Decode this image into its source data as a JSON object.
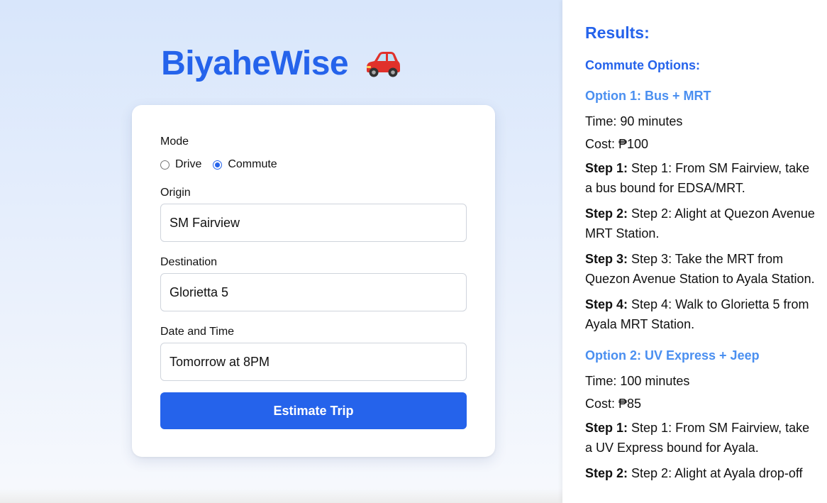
{
  "app": {
    "title": "BiyaheWise"
  },
  "form": {
    "mode_label": "Mode",
    "mode_options": [
      "Drive",
      "Commute"
    ],
    "mode_selected": "Commute",
    "origin_label": "Origin",
    "origin_value": "SM Fairview",
    "destination_label": "Destination",
    "destination_value": "Glorietta 5",
    "datetime_label": "Date and Time",
    "datetime_value": "Tomorrow at 8PM",
    "submit_label": "Estimate Trip"
  },
  "results": {
    "title": "Results:",
    "subtitle": "Commute Options:",
    "options": [
      {
        "title": "Option 1: Bus + MRT",
        "time": "Time: 90 minutes",
        "cost": "Cost: ₱100",
        "steps": [
          {
            "label": "Step 1:",
            "text": "Step 1: From SM Fairview, take a bus bound for EDSA/MRT."
          },
          {
            "label": "Step 2:",
            "text": "Step 2: Alight at Quezon Avenue MRT Station."
          },
          {
            "label": "Step 3:",
            "text": "Step 3: Take the MRT from Quezon Avenue Station to Ayala Station."
          },
          {
            "label": "Step 4:",
            "text": "Step 4: Walk to Glorietta 5 from Ayala MRT Station."
          }
        ]
      },
      {
        "title": "Option 2: UV Express + Jeep",
        "time": "Time: 100 minutes",
        "cost": "Cost: ₱85",
        "steps": [
          {
            "label": "Step 1:",
            "text": "Step 1: From SM Fairview, take a UV Express bound for Ayala."
          },
          {
            "label": "Step 2:",
            "text": "Step 2: Alight at Ayala drop-off"
          }
        ]
      }
    ]
  },
  "icons": {
    "title_icon": "car-icon"
  },
  "colors": {
    "accent": "#2563eb",
    "option_title": "#4a8ff0"
  }
}
